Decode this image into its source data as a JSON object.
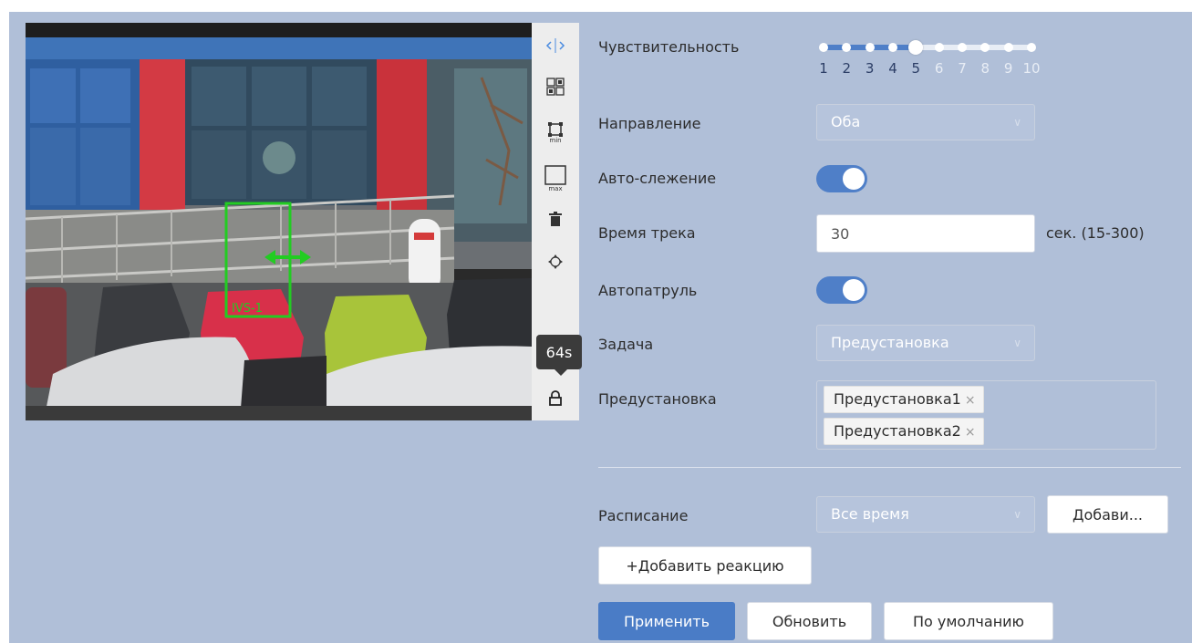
{
  "colors": {
    "panel_bg": "#b0bfd8",
    "accent": "#4a7cc6",
    "detection_box": "#22cc22"
  },
  "video": {
    "box_label": "IVS-1",
    "timer_tooltip": "64s"
  },
  "toolbar": {
    "icons": [
      "direction-arrows-icon",
      "grid-icon",
      "min-size-icon",
      "max-size-icon",
      "trash-icon",
      "move-icon",
      "lock-icon"
    ],
    "min_label": "min",
    "max_label": "max"
  },
  "form": {
    "sensitivity": {
      "label": "Чувствительность",
      "value": 5,
      "ticks": [
        "1",
        "2",
        "3",
        "4",
        "5",
        "6",
        "7",
        "8",
        "9",
        "10"
      ]
    },
    "direction": {
      "label": "Направление",
      "value": "Оба"
    },
    "auto_tracking": {
      "label": "Авто-слежение",
      "enabled": true
    },
    "track_time": {
      "label": "Время трека",
      "value": "30",
      "hint": "сек. (15-300)"
    },
    "auto_patrol": {
      "label": "Автопатруль",
      "enabled": true
    },
    "task": {
      "label": "Задача",
      "value": "Предустановка"
    },
    "preset": {
      "label": "Предустановка",
      "tags": [
        "Предустановка1",
        "Предустановка2"
      ],
      "remove_glyph": "×"
    },
    "schedule": {
      "label": "Расписание",
      "value": "Все время",
      "add_button": "Добави..."
    },
    "add_reaction_button": "+Добавить реакцию"
  },
  "actions": {
    "apply": "Применить",
    "refresh": "Обновить",
    "default": "По умолчанию"
  },
  "chevron_glyph": "∨"
}
